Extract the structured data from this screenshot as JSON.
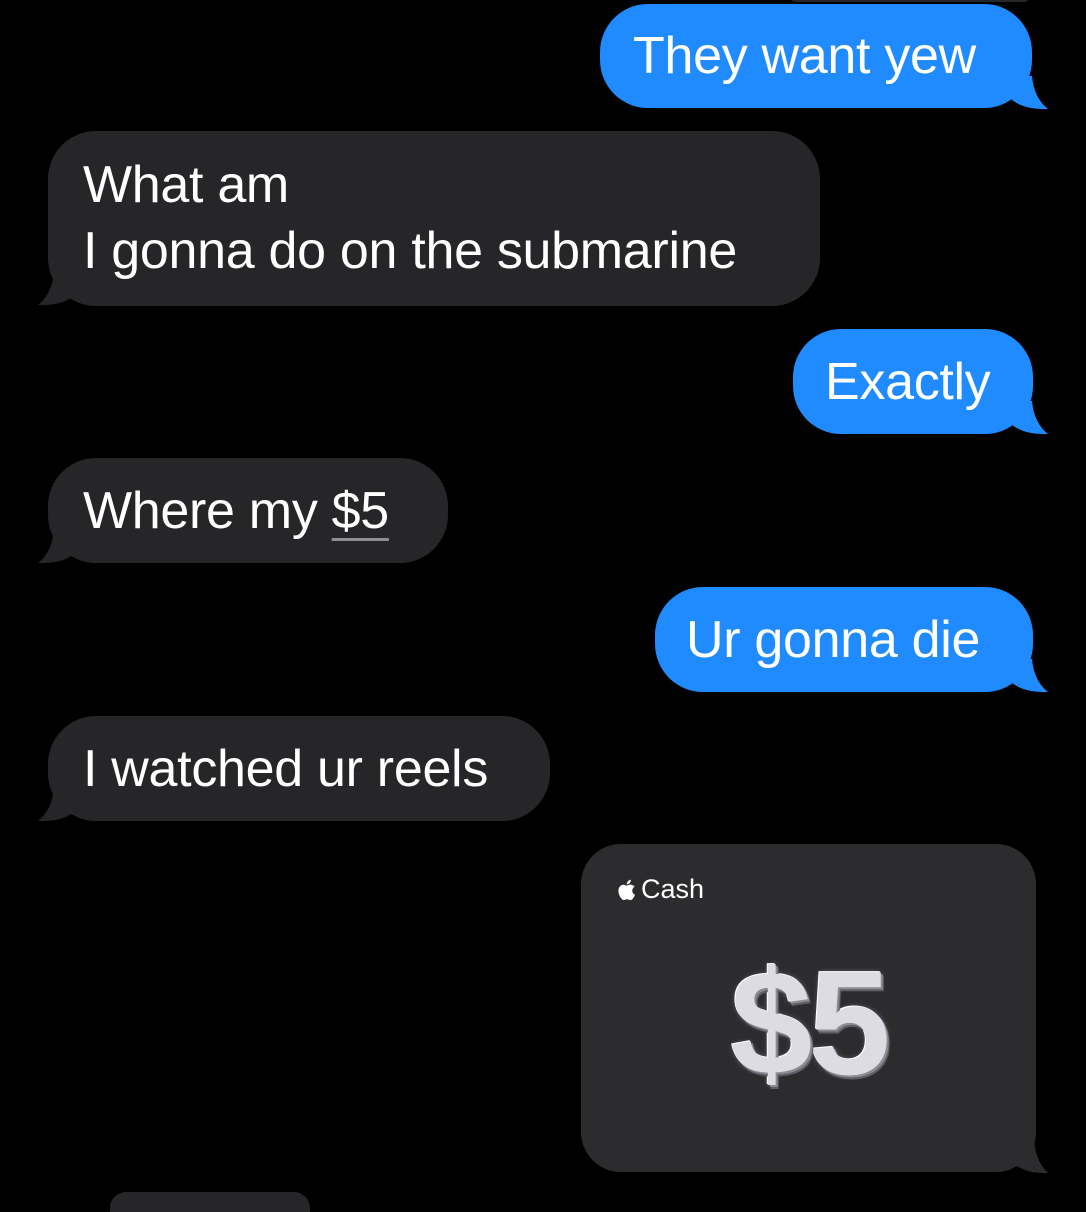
{
  "messages": [
    {
      "direction": "sent",
      "text": "They want yew"
    },
    {
      "direction": "received",
      "line1": "What am",
      "line2": "I gonna do on the submarine"
    },
    {
      "direction": "sent",
      "text": "Exactly"
    },
    {
      "direction": "received",
      "prefix": "Where my ",
      "link": "$5"
    },
    {
      "direction": "sent",
      "text": "Ur gonna die"
    },
    {
      "direction": "received",
      "text": "I watched ur reels"
    }
  ],
  "cash_card": {
    "brand_label": "Cash",
    "brand_icon": "apple-logo-icon",
    "amount": "$5"
  },
  "colors": {
    "background": "#000000",
    "sent_bubble": "#1f8bff",
    "received_bubble": "#262629",
    "cash_card": "#2c2c2e"
  }
}
